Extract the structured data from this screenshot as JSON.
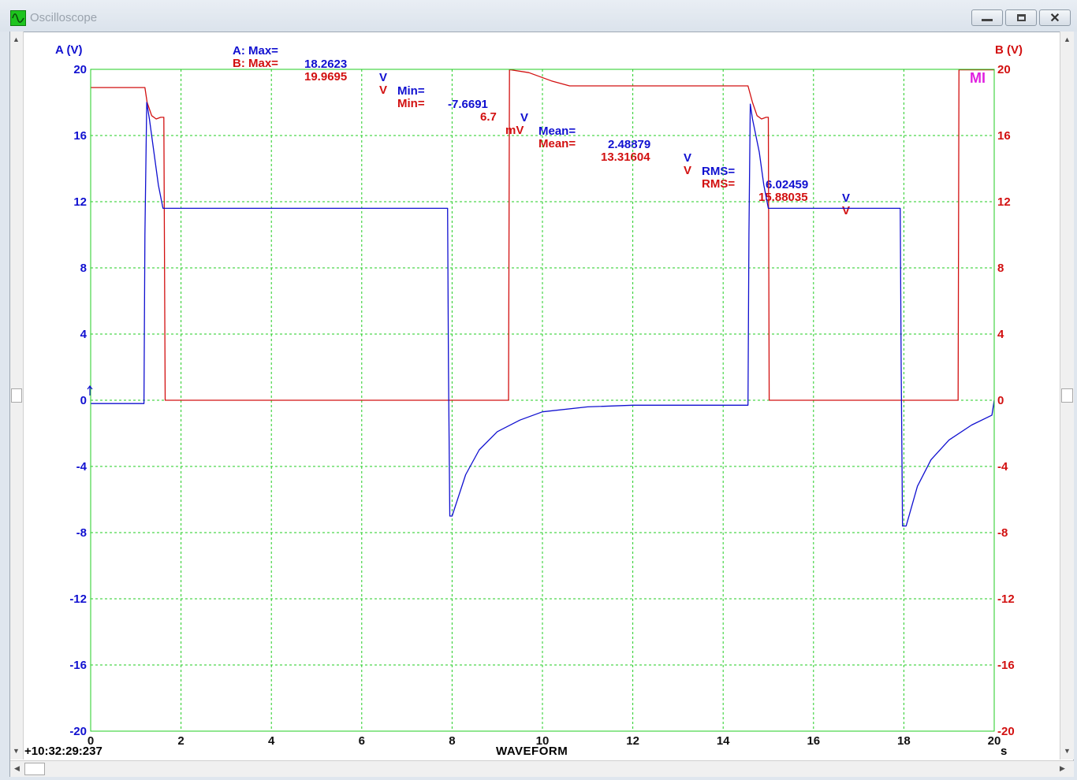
{
  "window": {
    "title": "Oscilloscope",
    "minimize_icon": "minimize-icon",
    "maximize_icon": "restore-icon",
    "close_icon": "close-icon"
  },
  "stats": {
    "a": {
      "max_label": "A: Max=",
      "max": "18.2623",
      "max_unit": "V",
      "min_label": "Min=",
      "min": "-7.6691",
      "min_unit": "V",
      "mean_label": "Mean=",
      "mean": "2.48879",
      "mean_unit": "V",
      "rms_label": "RMS=",
      "rms": "6.02459",
      "rms_unit": "V"
    },
    "b": {
      "max_label": "B: Max=",
      "max": "19.9695",
      "max_unit": "V",
      "min_label": "Min=",
      "min": "6.7",
      "min_unit": "mV",
      "mean_label": "Mean=",
      "mean": "13.31604",
      "mean_unit": "V",
      "rms_label": "RMS=",
      "rms": "15.88035",
      "rms_unit": "V"
    }
  },
  "footer": {
    "timestamp": "+10:32:29:237",
    "x_title": "WAVEFORM",
    "x_unit": "s"
  },
  "marker": "MI",
  "colors": {
    "channel_a": "#1010d0",
    "channel_b": "#d21010",
    "grid": "#22cc22",
    "marker": "#e020e0"
  },
  "chart_data": {
    "type": "line",
    "title": "",
    "xlabel": "WAVEFORM",
    "x_unit": "s",
    "ylabel_left": "A (V)",
    "ylabel_right": "B (V)",
    "xlim": [
      0,
      20
    ],
    "ylim": [
      -20,
      20
    ],
    "x_ticks": [
      0,
      2,
      4,
      6,
      8,
      10,
      12,
      14,
      16,
      18,
      20
    ],
    "y_ticks": [
      -20,
      -16,
      -12,
      -8,
      -4,
      0,
      4,
      8,
      12,
      16,
      20
    ],
    "grid": true,
    "series": [
      {
        "name": "A (V)",
        "axis": "left",
        "x": [
          0,
          1.18,
          1.2,
          1.24,
          1.3,
          1.4,
          1.5,
          1.6,
          2,
          4,
          6,
          7.9,
          7.92,
          7.95,
          8.0,
          8.3,
          8.6,
          9.0,
          9.5,
          10.0,
          11.0,
          12.0,
          13.0,
          14.55,
          14.57,
          14.6,
          14.65,
          14.8,
          14.9,
          15.0,
          16,
          17,
          17.92,
          17.94,
          17.97,
          18.05,
          18.3,
          18.6,
          19.0,
          19.5,
          19.95,
          20.0
        ],
        "values": [
          -0.2,
          -0.2,
          10,
          18.0,
          17.0,
          15.0,
          13.0,
          11.6,
          11.6,
          11.6,
          11.6,
          11.6,
          2.0,
          -7.0,
          -7.0,
          -4.5,
          -3.0,
          -1.9,
          -1.2,
          -0.7,
          -0.4,
          -0.3,
          -0.3,
          -0.3,
          10,
          17.9,
          17.0,
          15.0,
          13.0,
          11.6,
          11.6,
          11.6,
          11.6,
          2.0,
          -7.6,
          -7.6,
          -5.2,
          -3.6,
          -2.4,
          -1.5,
          -0.9,
          0.0
        ]
      },
      {
        "name": "B (V)",
        "axis": "right",
        "x": [
          0,
          1.2,
          1.25,
          1.35,
          1.45,
          1.55,
          1.62,
          1.65,
          1.66,
          6,
          9.25,
          9.27,
          9.3,
          9.7,
          10.2,
          10.6,
          12,
          14.55,
          14.65,
          14.75,
          14.85,
          14.95,
          15.0,
          15.02,
          18,
          19.2,
          19.22,
          20.0
        ],
        "values": [
          18.9,
          18.9,
          18.0,
          17.2,
          17.0,
          17.1,
          17.1,
          0,
          0,
          0,
          0,
          19.97,
          19.97,
          19.8,
          19.3,
          19.0,
          19.0,
          19.0,
          18.0,
          17.2,
          17.0,
          17.1,
          17.1,
          0,
          0,
          0,
          19.97,
          19.97
        ]
      }
    ]
  }
}
